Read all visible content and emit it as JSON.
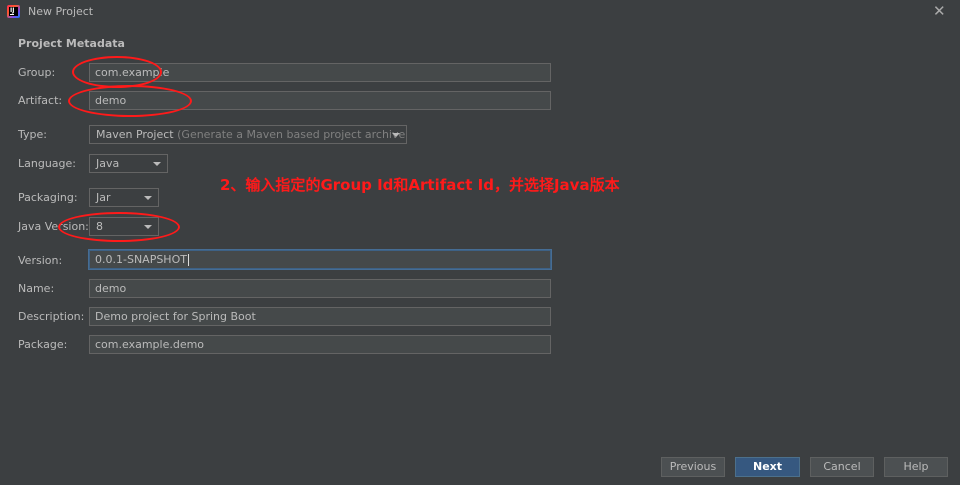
{
  "window": {
    "title": "New Project",
    "icon": "intellij-idea-icon",
    "close_icon": "close-icon"
  },
  "section_title": "Project Metadata",
  "fields": {
    "group": {
      "label": "Group:",
      "value": "com.example"
    },
    "artifact": {
      "label": "Artifact:",
      "value": "demo"
    },
    "type": {
      "label": "Type:",
      "value": "Maven Project",
      "hint": "(Generate a Maven based project archive.)"
    },
    "language": {
      "label": "Language:",
      "value": "Java"
    },
    "packaging": {
      "label": "Packaging:",
      "value": "Jar"
    },
    "java_version": {
      "label": "Java Version:",
      "value": "8"
    },
    "version": {
      "label": "Version:",
      "value": "0.0.1-SNAPSHOT"
    },
    "name": {
      "label": "Name:",
      "value": "demo"
    },
    "description": {
      "label": "Description:",
      "value": "Demo project for Spring Boot"
    },
    "package": {
      "label": "Package:",
      "value": "com.example.demo"
    }
  },
  "annotation": {
    "text": "2、输入指定的Group Id和Artifact Id，并选择Java版本",
    "color": "#ff1a1a"
  },
  "buttons": {
    "previous": "Previous",
    "next": "Next",
    "cancel": "Cancel",
    "help": "Help"
  },
  "colors": {
    "background": "#3c3f41",
    "field_background": "#45494a",
    "primary_button": "#365880"
  }
}
